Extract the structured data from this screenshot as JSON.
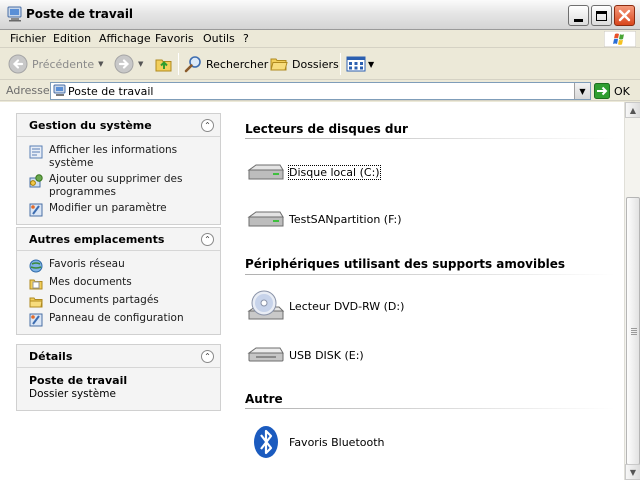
{
  "window": {
    "title": "Poste de travail"
  },
  "menu": [
    "Fichier",
    "Edition",
    "Affichage",
    "Favoris",
    "Outils",
    "?"
  ],
  "toolbar": {
    "back_label": "Précédente",
    "search_label": "Rechercher",
    "folders_label": "Dossiers"
  },
  "address": {
    "label": "Adresse",
    "value": "Poste de travail",
    "go_label": "OK"
  },
  "system_tasks": {
    "title": "Gestion du système",
    "items": [
      {
        "label": "Afficher les informations système",
        "icon": "system-info-icon"
      },
      {
        "label": "Ajouter ou supprimer des programmes",
        "icon": "add-remove-programs-icon"
      },
      {
        "label": "Modifier un paramètre",
        "icon": "control-panel-icon"
      }
    ]
  },
  "other_places": {
    "title": "Autres emplacements",
    "items": [
      {
        "label": "Favoris réseau",
        "icon": "network-places-icon"
      },
      {
        "label": "Mes documents",
        "icon": "my-documents-icon"
      },
      {
        "label": "Documents partagés",
        "icon": "shared-folder-icon"
      },
      {
        "label": "Panneau de configuration",
        "icon": "control-panel-icon"
      }
    ]
  },
  "details": {
    "title": "Détails",
    "name": "Poste de travail",
    "type": "Dossier système"
  },
  "groups": [
    {
      "title": "Lecteurs de disques dur",
      "items": [
        {
          "label": "Disque local (C:)",
          "icon": "hard-disk-icon",
          "selected": true
        },
        {
          "label": "TestSANpartition (F:)",
          "icon": "hard-disk-icon",
          "selected": false
        }
      ]
    },
    {
      "title": "Périphériques utilisant des supports amovibles",
      "items": [
        {
          "label": "Lecteur DVD-RW (D:)",
          "icon": "dvd-drive-icon"
        },
        {
          "label": "USB DISK (E:)",
          "icon": "removable-disk-icon"
        }
      ]
    },
    {
      "title": "Autre",
      "items": [
        {
          "label": "Favoris Bluetooth",
          "icon": "bluetooth-icon"
        }
      ]
    }
  ],
  "colors": {
    "chrome": "#ece9d8",
    "panel": "#f4f4f4",
    "close_button": "#d9461c",
    "go_arrow": "#2f9e2f",
    "bluetooth": "#1b5bbf"
  }
}
